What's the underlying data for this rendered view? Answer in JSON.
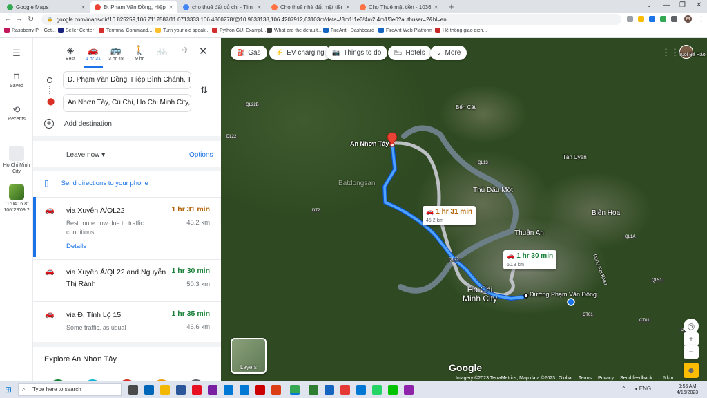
{
  "browser": {
    "tabs": [
      {
        "title": "Google Maps",
        "color": "#34a853"
      },
      {
        "title": "Đ. Phạm Văn Đồng, Hiệp Bình C",
        "color": "#ea4335"
      },
      {
        "title": "cho thuê đất củ chi - Tìm trên G",
        "color": "#4285f4"
      },
      {
        "title": "Cho thuê nhà đất mặt tiền trang",
        "color": "#ff7043"
      },
      {
        "title": "Cho Thuê mặt tiền - 103653795",
        "color": "#ff7043"
      }
    ],
    "url": "google.com/maps/dir/10.825259,106.7112587/11.0713333,106.4860278/@10.9633138,106.4207912,63103m/data=!3m1!1e3!4m2!4m1!3e0?authuser=2&hl=en",
    "bookmarks": [
      {
        "label": "Raspberry Pi - Get...",
        "color": "#c2185b"
      },
      {
        "label": "Seller Center",
        "color": "#1a237e"
      },
      {
        "label": "Terminal Command...",
        "color": "#d32f2f"
      },
      {
        "label": "Turn your old speak...",
        "color": "#fbc02d"
      },
      {
        "label": "Python GUI Exampl...",
        "color": "#d32f2f"
      },
      {
        "label": "What are the default...",
        "color": "#424242"
      },
      {
        "label": "FireAnt - Dashboard",
        "color": "#1565c0"
      },
      {
        "label": "FireAnt Web Platform",
        "color": "#1565c0"
      },
      {
        "label": "Hệ thống giao dịch...",
        "color": "#c62828"
      }
    ]
  },
  "rail": {
    "saved": "Saved",
    "recents": "Recents",
    "hcm": "Ho Chi Minh City",
    "coord": "11°04'16.8\" 106°29'09.?"
  },
  "panel": {
    "modes": [
      {
        "icon": "◈",
        "label": "Best"
      },
      {
        "icon": "🚗",
        "label": "1 hr 31"
      },
      {
        "icon": "🚌",
        "label": "3 hr 48"
      },
      {
        "icon": "🚶",
        "label": "9 hr"
      },
      {
        "icon": "🚲",
        "label": ""
      },
      {
        "icon": "✈",
        "label": ""
      }
    ],
    "origin": "Đ. Phạm Văn Đồng, Hiệp Bình Chánh, Thủ",
    "destination": "An Nhơn Tây, Củ Chi, Ho Chi Minh City, Vi",
    "add_destination": "Add destination",
    "leave_now": "Leave now",
    "options": "Options",
    "send_to_phone": "Send directions to your phone",
    "routes": [
      {
        "name": "via Xuyên Á/QL22",
        "time": "1 hr 31 min",
        "time_color": "#b06000",
        "distance": "45.2 km",
        "note": "Best route now due to traffic conditions",
        "details": "Details"
      },
      {
        "name": "via Xuyên Á/QL22 and Nguyễn Thị Rành",
        "time": "1 hr 30 min",
        "time_color": "#188038",
        "distance": "50.3 km",
        "note": "",
        "details": ""
      },
      {
        "name": "via Đ. Tỉnh Lộ 15",
        "time": "1 hr 35 min",
        "time_color": "#188038",
        "distance": "46.6 km",
        "note": "Some traffic, as usual",
        "details": ""
      }
    ],
    "explore": "Explore An Nhơn Tây"
  },
  "map": {
    "chips": [
      {
        "icon": "⛽",
        "label": "Gas"
      },
      {
        "icon": "⚡",
        "label": "EV charging"
      },
      {
        "icon": "📷",
        "label": "Things to do"
      },
      {
        "icon": "🛏",
        "label": "Hotels"
      },
      {
        "icon": "⌄",
        "label": "More"
      }
    ],
    "labels": {
      "an_nhon_tay": "An Nhơn Tây",
      "ben_cat": "Bến Cát",
      "tan_uyen": "Tân Uyên",
      "thu_dau_mot": "Thủ Dầu Một",
      "bien_hoa": "Biên Hoa",
      "thuan_an": "Thuận An",
      "hcm_city": "Ho Chi Minh City",
      "pham_van_dong": "Đường Phạm Văn Đồng",
      "dong_nai_river": "Dong Nai River",
      "watermark": "Batdongsan",
      "profile_name": "Tuoi Bá Hảo"
    },
    "road_tags": [
      "QL22B",
      "DL22",
      "QL13",
      "DT2",
      "QL22",
      "CT01",
      "QL1A",
      "QL51",
      "CT01",
      "DT01"
    ],
    "box1": {
      "time": "1 hr 31 min",
      "distance": "45.2 km",
      "color": "#b06000"
    },
    "box2": {
      "time": "1 hr 30 min",
      "distance": "50.3 km",
      "color": "#188038"
    },
    "layers": "Layers",
    "google": "Google",
    "attribution": [
      "Imagery ©2023 TerraMetrics, Map data ©2023",
      "Global",
      "Terms",
      "Privacy",
      "Send feedback",
      "5 km"
    ],
    "route_color": "#1a73e8",
    "alt_route_color": "#bdc1c6"
  },
  "taskbar": {
    "search": "Type here to search",
    "time": "9:56 AM",
    "date": "4/16/2023",
    "apps": [
      "#4a4a4a",
      "#0067b8",
      "#f3b700",
      "#2b579a",
      "#e81123",
      "#7b1fa2",
      "#0078d4",
      "#dc3e15",
      "#c00",
      "#34a853",
      "#2e7d32",
      "#1565c0",
      "#e53935",
      "#0078d4",
      "#25d366",
      "#00c300",
      "#8e24aa"
    ]
  }
}
